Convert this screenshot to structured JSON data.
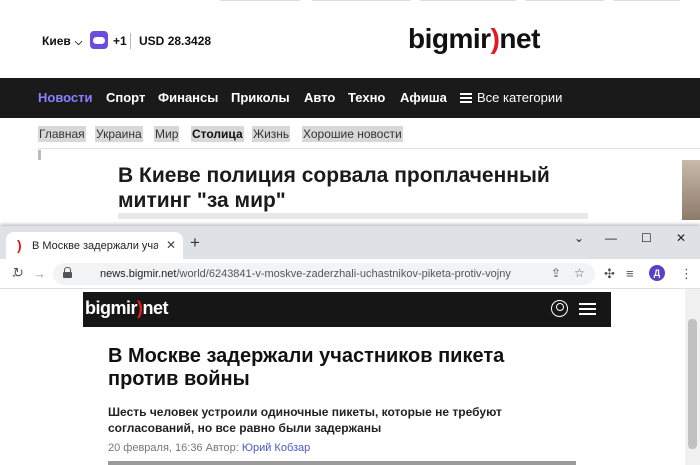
{
  "background_page": {
    "city": "Киев",
    "temperature": "+1",
    "currency_code": "USD",
    "currency_rate": "28.3428",
    "logo_text_left": "bigmir",
    "logo_paren": ")",
    "logo_text_right": "net",
    "nav": [
      "Новости",
      "Спорт",
      "Финансы",
      "Приколы",
      "Авто",
      "Техно",
      "Афиша"
    ],
    "nav_all_categories": "Все категории",
    "subnav": [
      "Главная",
      "Украина",
      "Мир",
      "Столица",
      "Жизнь",
      "Хорошие новости"
    ],
    "headline": "В Киеве полиция сорвала проплаченный митинг \"за мир\""
  },
  "browser": {
    "tab_title": "В Москве задержали участников пикета против войны",
    "url_domain": "news.bigmir.net",
    "url_path": "/world/6243841-v-moskve-zaderzhali-uchastnikov-piketa-protiv-vojny",
    "profile_initial": "Д"
  },
  "article": {
    "logo_text_left": "bigmir",
    "logo_paren": ")",
    "logo_text_right": "net",
    "title": "В Москве задержали участников пикета против войны",
    "lead": "Шесть человек устроили одиночные пикеты, которые не требуют согласований, но все равно были задержаны",
    "date": "20 февраля, 16:36",
    "author_label": "Автор:",
    "author": "Юрий Кобзар"
  },
  "colors": {
    "brand_red": "#e3191c",
    "nav_active": "#8a80ff",
    "dark_bar": "#1a1a1a"
  }
}
